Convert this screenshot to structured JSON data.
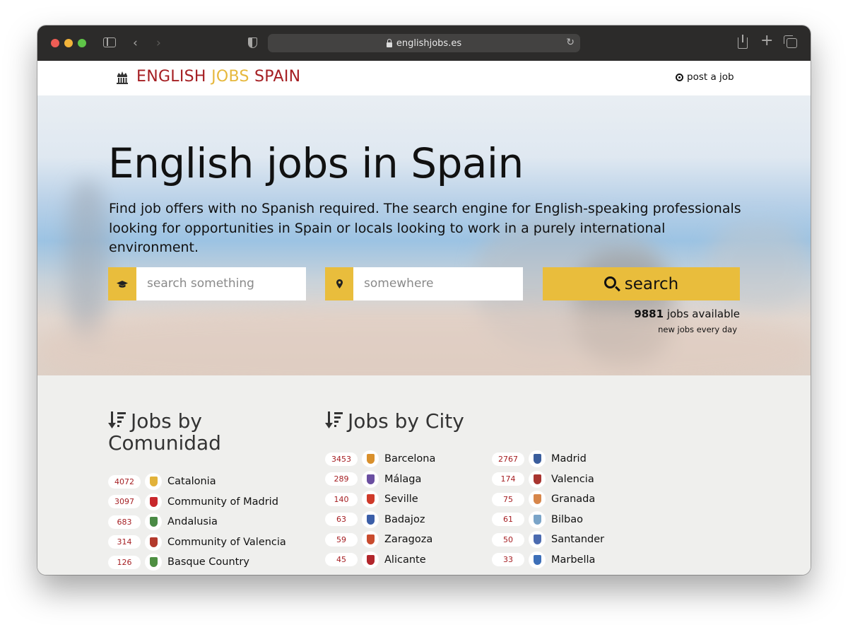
{
  "browser": {
    "url": "englishjobs.es"
  },
  "brand": {
    "part1": "ENGLISH ",
    "part2": "JOBS",
    "part3": " SPAIN",
    "color_red": "#a51e22",
    "color_gold": "#e6b83d"
  },
  "nav": {
    "post_job": "post a job"
  },
  "hero": {
    "title": "English jobs in Spain",
    "subtitle": "Find job offers with no Spanish required. The search engine for English-speaking professionals looking for opportunities in Spain or locals looking to work in a purely international environment.",
    "search_placeholder": "search something",
    "location_placeholder": "somewhere",
    "search_button": "search",
    "jobs_count": "9881",
    "jobs_label": " jobs available",
    "new_jobs": "new jobs every day"
  },
  "comunidad": {
    "title_line1": "Jobs by",
    "title_line2": "Comunidad",
    "items": [
      {
        "count": "4072",
        "name": "Catalonia",
        "flag": "#e2b23a"
      },
      {
        "count": "3097",
        "name": "Community of Madrid",
        "flag": "#c8282c"
      },
      {
        "count": "683",
        "name": "Andalusia",
        "flag": "#4a8a45"
      },
      {
        "count": "314",
        "name": "Community of Valencia",
        "flag": "#b33a2c"
      },
      {
        "count": "126",
        "name": "Basque Country",
        "flag": "#4e8f42"
      }
    ]
  },
  "cities": {
    "title": "Jobs by City",
    "col1": [
      {
        "count": "3453",
        "name": "Barcelona",
        "flag": "#d9902c"
      },
      {
        "count": "289",
        "name": "Málaga",
        "flag": "#6b4fa1"
      },
      {
        "count": "140",
        "name": "Seville",
        "flag": "#cf3a2a"
      },
      {
        "count": "63",
        "name": "Badajoz",
        "flag": "#3b5ea8"
      },
      {
        "count": "59",
        "name": "Zaragoza",
        "flag": "#c94b2e"
      },
      {
        "count": "45",
        "name": "Alicante",
        "flag": "#b2262b"
      }
    ],
    "col2": [
      {
        "count": "2767",
        "name": "Madrid",
        "flag": "#3a5d9c"
      },
      {
        "count": "174",
        "name": "Valencia",
        "flag": "#a8352f"
      },
      {
        "count": "75",
        "name": "Granada",
        "flag": "#d7864a"
      },
      {
        "count": "61",
        "name": "Bilbao",
        "flag": "#7aa4c8"
      },
      {
        "count": "50",
        "name": "Santander",
        "flag": "#4b6bb0"
      },
      {
        "count": "33",
        "name": "Marbella",
        "flag": "#3d6fb8"
      }
    ]
  }
}
